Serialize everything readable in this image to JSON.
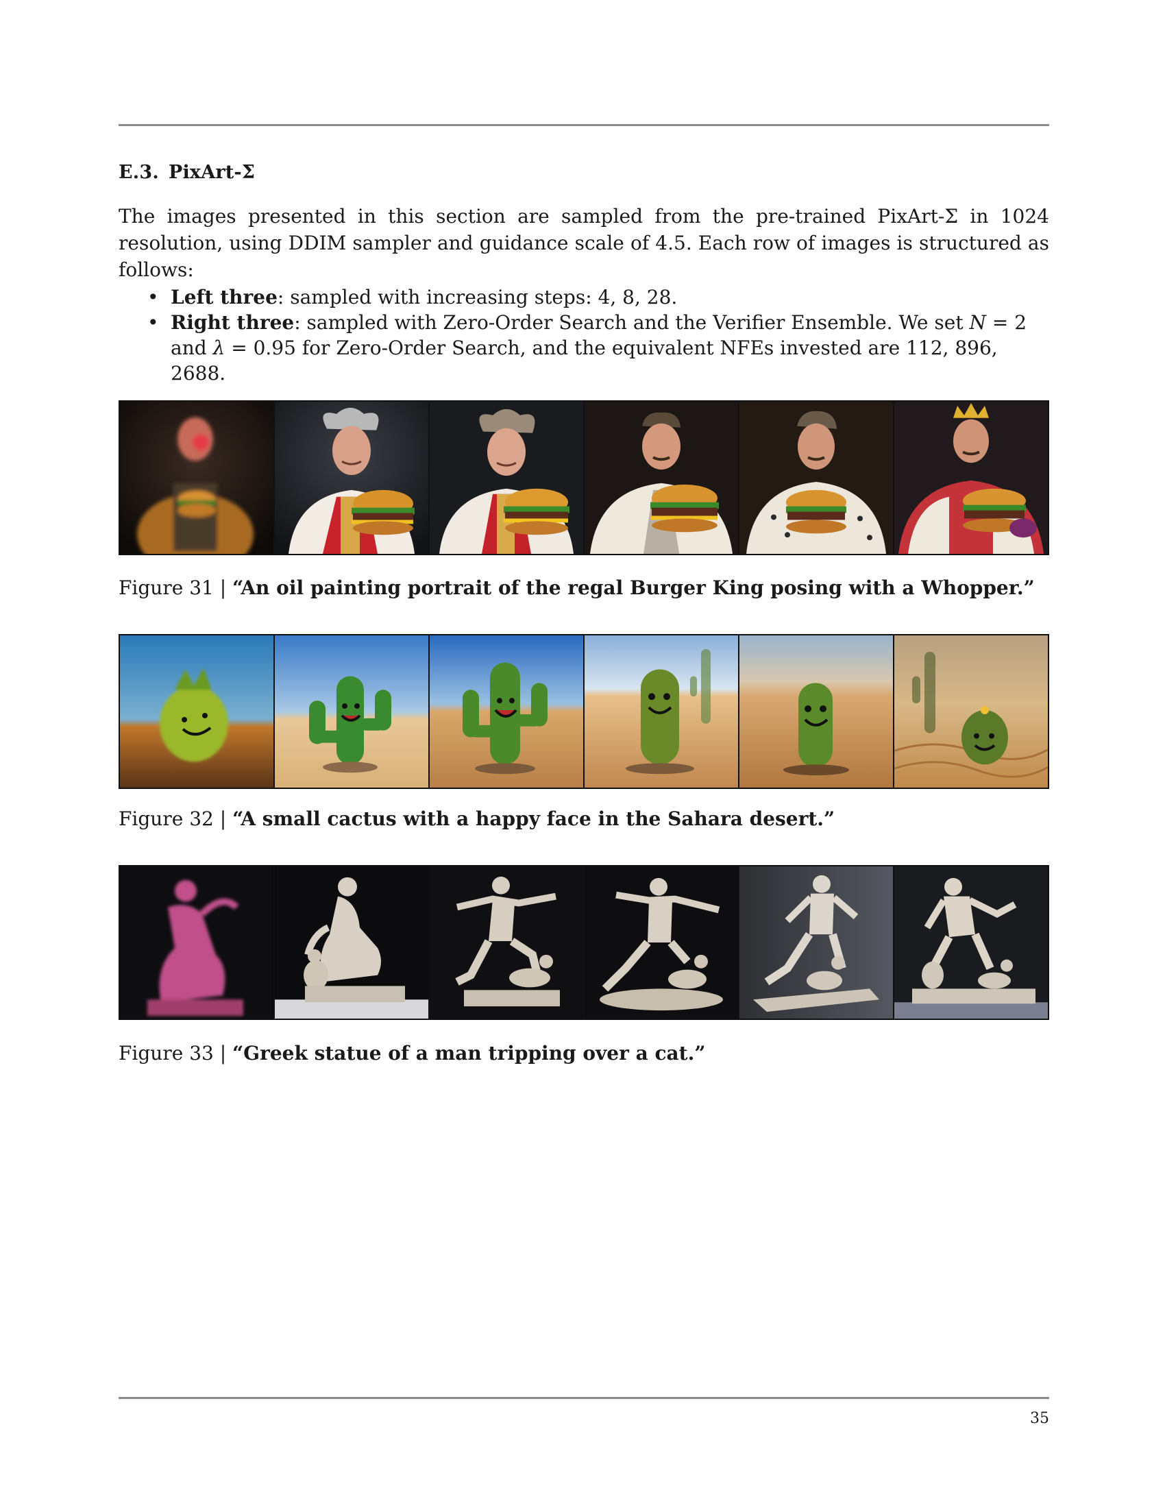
{
  "section": {
    "number": "E.3.",
    "title": "PixArt-Σ"
  },
  "intro": "The images presented in this section are sampled from the pre-trained PixArt-Σ in 1024 resolution, using DDIM sampler and guidance scale of 4.5. Each row of images is structured as follows:",
  "bullets": [
    {
      "lead": "Left three",
      "text": ": sampled with increasing steps: 4, 8, 28."
    },
    {
      "lead": "Right three",
      "text_a": ": sampled with Zero-Order Search and the Verifier Ensemble. We set ",
      "var_n": "N",
      "text_b": " = 2 and ",
      "var_lambda": "λ",
      "text_c": " = 0.95 for Zero-Order Search, and the equivalent NFEs invested are 112, 896, 2688."
    }
  ],
  "figures": [
    {
      "label": "Figure 31 | ",
      "prompt": "“An oil painting portrait of the regal Burger King posing with a Whopper.”",
      "subject": "burger-king"
    },
    {
      "label": "Figure 32 | ",
      "prompt": "“A small cactus with a happy face in the Sahara desert.”",
      "subject": "cactus"
    },
    {
      "label": "Figure 33 | ",
      "prompt": "“Greek statue of a man tripping over a cat.”",
      "subject": "statue"
    }
  ],
  "page_number": "35"
}
